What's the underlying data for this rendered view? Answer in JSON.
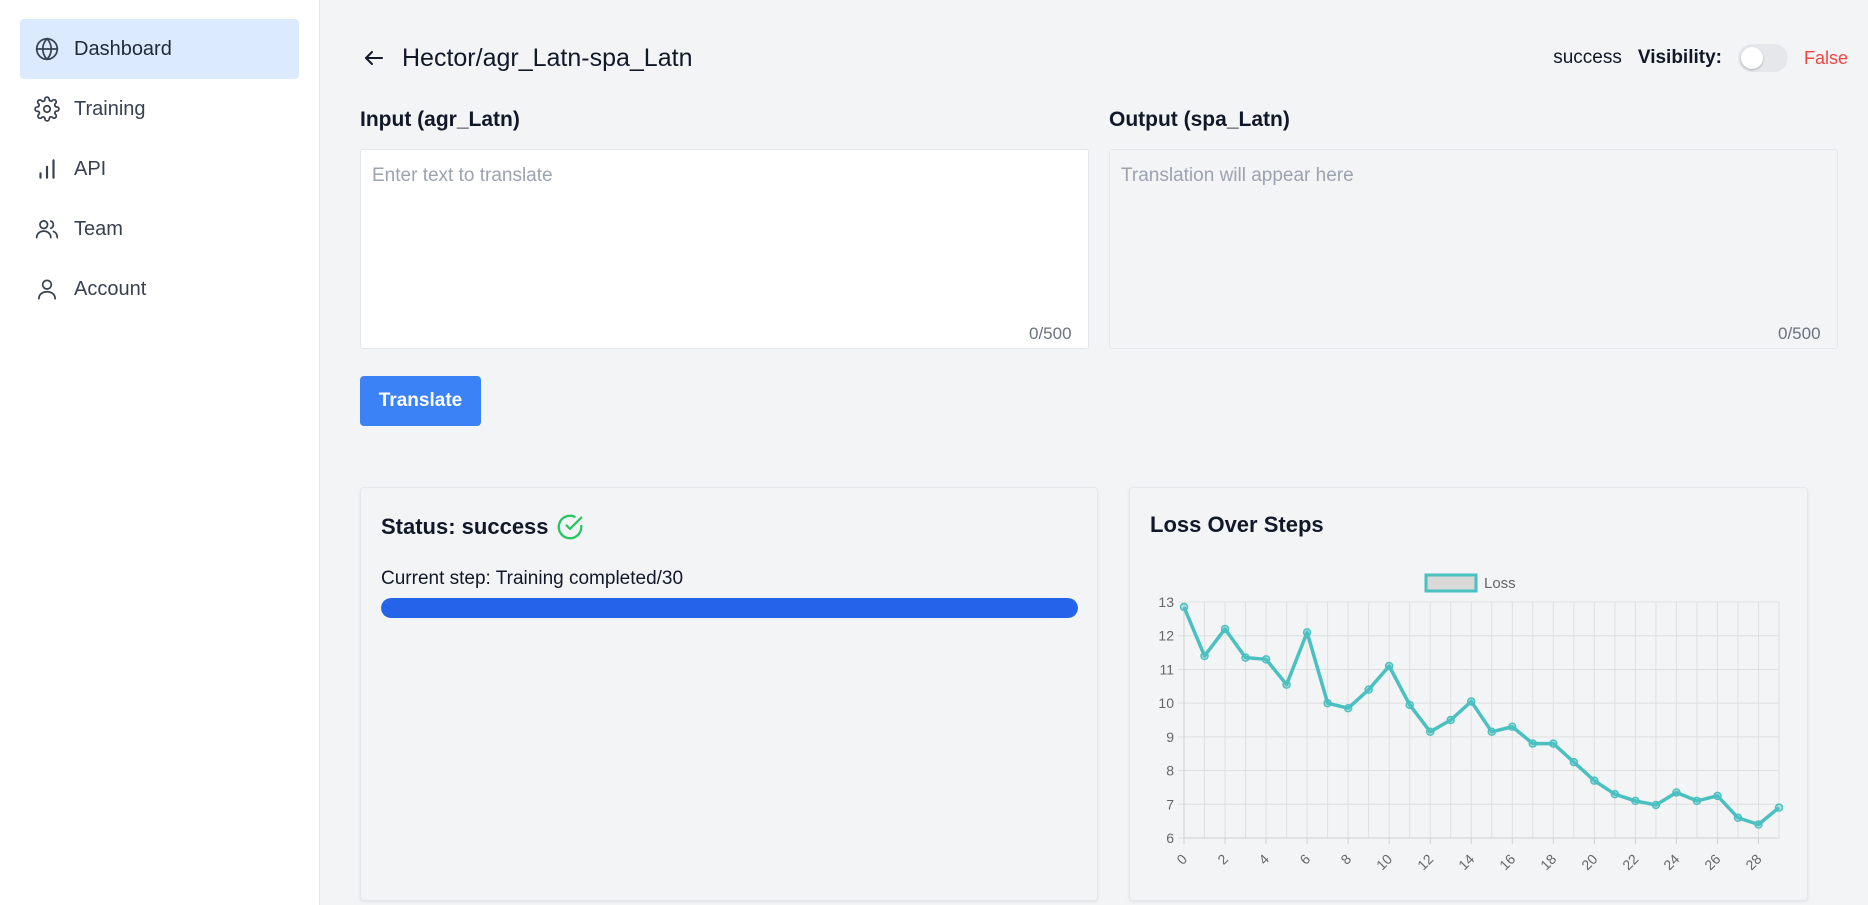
{
  "sidebar": {
    "items": [
      {
        "label": "Dashboard",
        "icon": "globe-icon",
        "active": true
      },
      {
        "label": "Training",
        "icon": "gear-icon",
        "active": false
      },
      {
        "label": "API",
        "icon": "bar-chart-icon",
        "active": false
      },
      {
        "label": "Team",
        "icon": "users-icon",
        "active": false
      },
      {
        "label": "Account",
        "icon": "user-icon",
        "active": false
      }
    ]
  },
  "header": {
    "title": "Hector/agr_Latn-spa_Latn",
    "status": "success",
    "visibility_label": "Visibility:",
    "visibility_value": "False",
    "visibility_on": false
  },
  "input": {
    "label": "Input (agr_Latn)",
    "placeholder": "Enter text to translate",
    "value": "",
    "count": "0/500"
  },
  "output": {
    "label": "Output (spa_Latn)",
    "placeholder": "Translation will appear here",
    "value": "",
    "count": "0/500"
  },
  "translate_button": "Translate",
  "status_card": {
    "title": "Status: success",
    "step_text": "Current step: Training completed/30",
    "progress": 1.0
  },
  "chart_card": {
    "title": "Loss Over Steps"
  },
  "colors": {
    "accent": "#3b82f6",
    "progress": "#2563eb",
    "line": "#4bc0c0",
    "success": "#22c55e",
    "danger": "#ef4444"
  },
  "chart_data": {
    "type": "line",
    "title": "Loss Over Steps",
    "xlabel": "",
    "ylabel": "",
    "x": [
      0,
      1,
      2,
      3,
      4,
      5,
      6,
      7,
      8,
      9,
      10,
      11,
      12,
      13,
      14,
      15,
      16,
      17,
      18,
      19,
      20,
      21,
      22,
      23,
      24,
      25,
      26,
      27,
      28,
      29
    ],
    "series": [
      {
        "name": "Loss",
        "values": [
          12.85,
          11.4,
          12.2,
          11.35,
          11.3,
          10.55,
          12.1,
          10.0,
          9.85,
          10.4,
          11.1,
          9.95,
          9.15,
          9.5,
          10.05,
          9.15,
          9.3,
          8.8,
          8.8,
          8.25,
          7.7,
          7.3,
          7.1,
          6.98,
          7.35,
          7.1,
          7.25,
          6.6,
          6.4,
          6.9
        ]
      }
    ],
    "xlim": [
      0,
      29
    ],
    "ylim": [
      6,
      13
    ],
    "x_ticks": [
      0,
      2,
      4,
      6,
      8,
      10,
      12,
      14,
      16,
      18,
      20,
      22,
      24,
      26,
      28
    ],
    "y_ticks": [
      6,
      7,
      8,
      9,
      10,
      11,
      12,
      13
    ],
    "grid": true,
    "legend": "top-center"
  }
}
